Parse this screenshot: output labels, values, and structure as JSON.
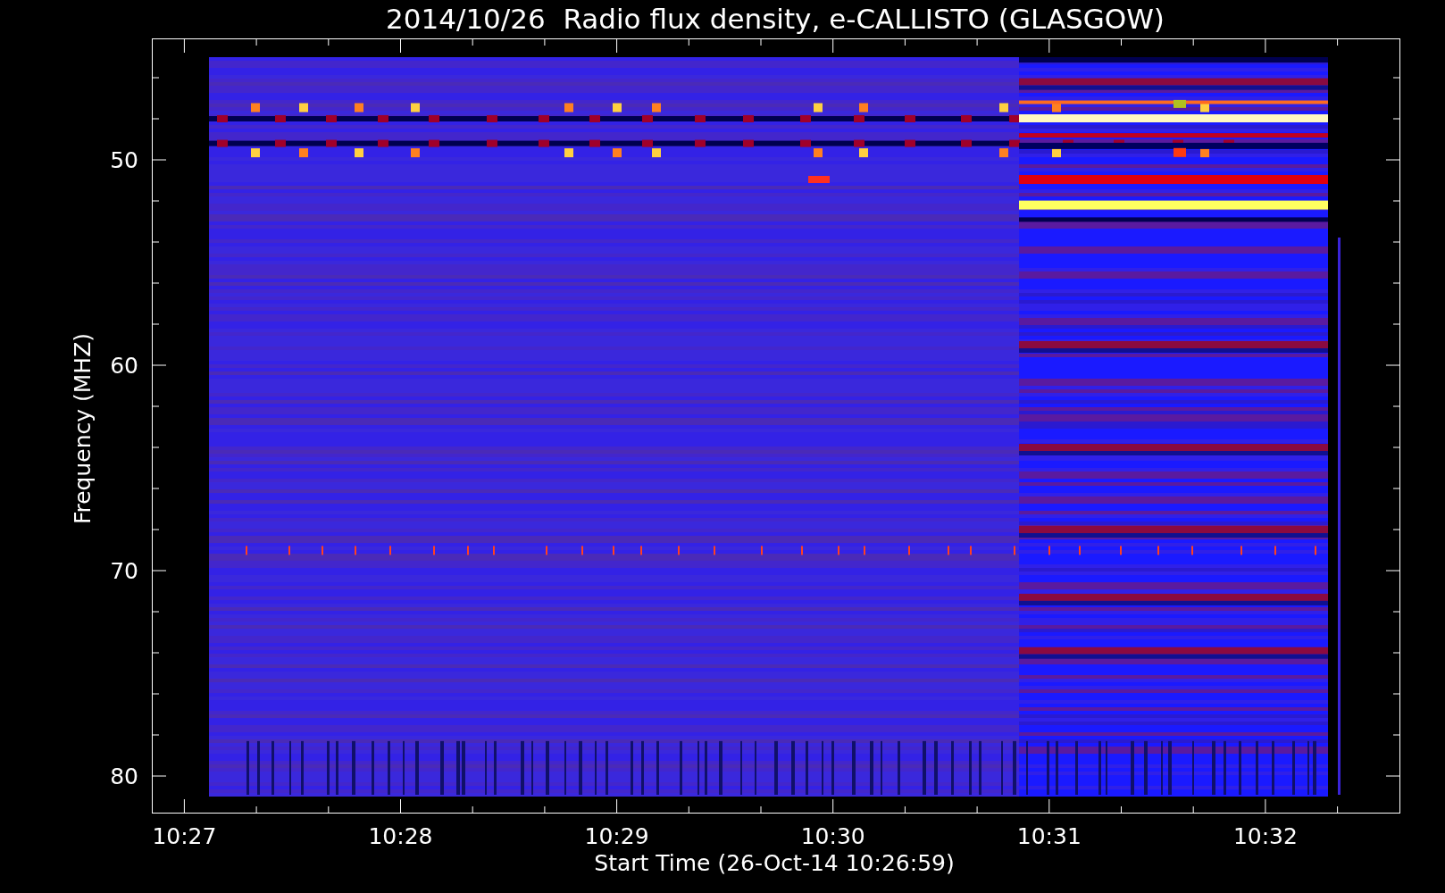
{
  "title": "2014/10/26  Radio flux density, e-CALLISTO (GLASGOW)",
  "y_axis": {
    "label": "Frequency (MHZ)",
    "tick_labels": [
      "50",
      "60",
      "70",
      "80"
    ]
  },
  "x_axis": {
    "label": "Start Time (26-Oct-14 10:26:59)",
    "tick_labels": [
      "10:27",
      "10:28",
      "10:29",
      "10:30",
      "10:31",
      "10:32"
    ]
  }
}
